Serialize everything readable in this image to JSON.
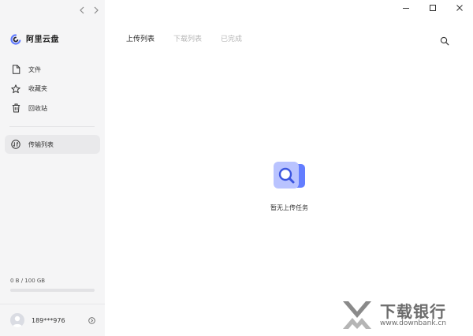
{
  "app": {
    "brand_name": "阿里云盘",
    "brand_color": "#637dff"
  },
  "nav": {
    "back_icon": "chevron-left-icon",
    "forward_icon": "chevron-right-icon"
  },
  "sidebar": {
    "items": [
      {
        "label": "文件",
        "icon": "file-icon"
      },
      {
        "label": "收藏夹",
        "icon": "star-icon"
      },
      {
        "label": "回收站",
        "icon": "trash-icon"
      }
    ],
    "transfer": {
      "label": "传输列表",
      "icon": "transfer-icon",
      "active": true
    }
  },
  "storage": {
    "text": "0 B / 100 GB",
    "used_fraction": 0
  },
  "user": {
    "name": "189***976"
  },
  "window_controls": [
    "minimize-icon",
    "maximize-icon",
    "close-icon"
  ],
  "main": {
    "tabs": [
      {
        "label": "上传列表",
        "active": true
      },
      {
        "label": "下载列表",
        "active": false
      },
      {
        "label": "已完成",
        "active": false
      }
    ],
    "empty_text": "暂无上传任务"
  },
  "watermark": {
    "title": "下载银行",
    "url": "www.downbank.cn"
  }
}
